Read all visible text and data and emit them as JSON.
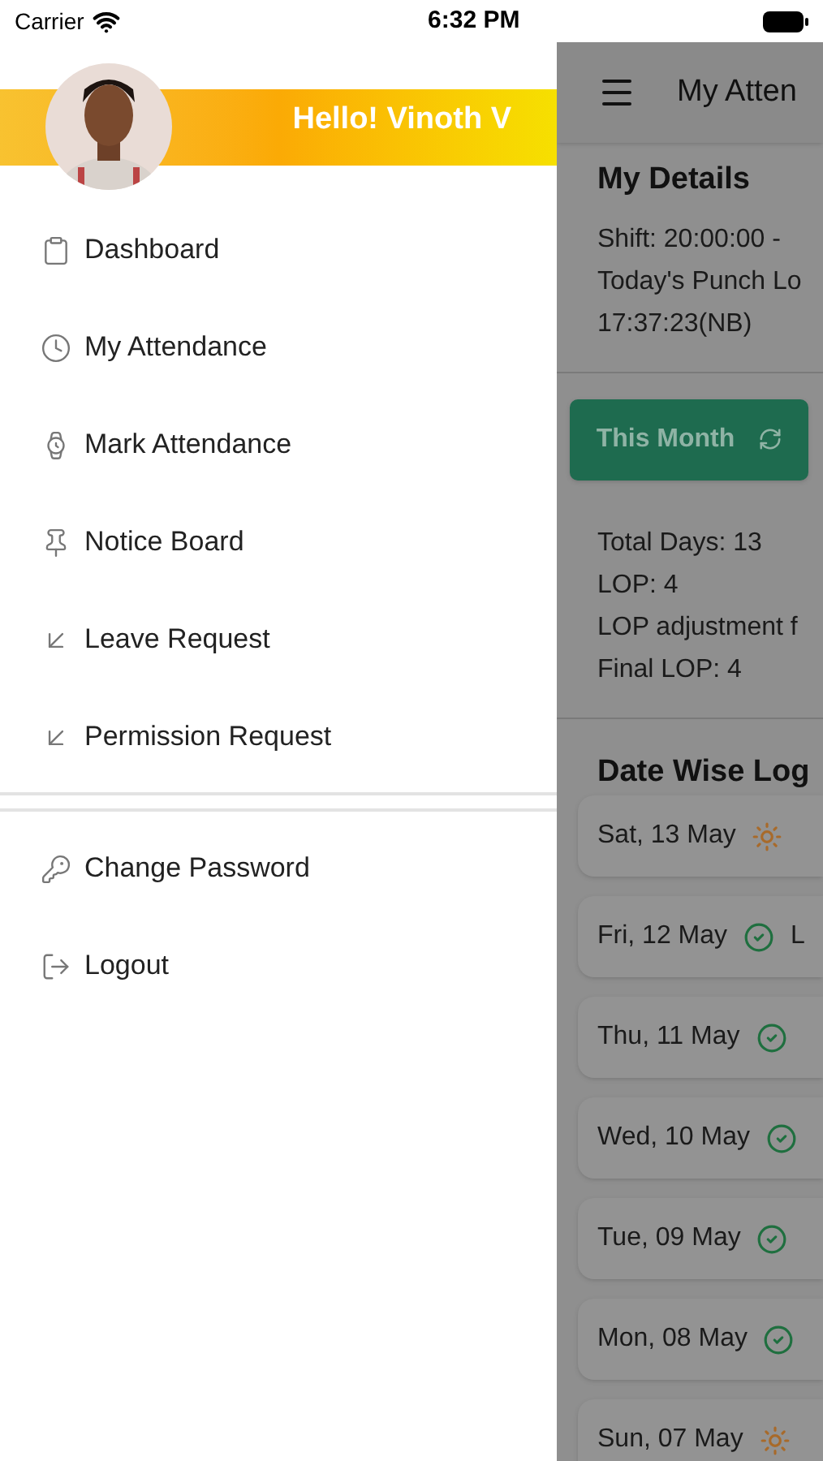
{
  "status_bar": {
    "carrier": "Carrier",
    "time": "6:32 PM"
  },
  "drawer": {
    "greeting": "Hello! Vinoth V",
    "items": [
      {
        "label": "Dashboard"
      },
      {
        "label": "My Attendance"
      },
      {
        "label": "Mark Attendance"
      },
      {
        "label": "Notice Board"
      },
      {
        "label": "Leave Request"
      },
      {
        "label": "Permission Request"
      }
    ],
    "account_items": [
      {
        "label": "Change Password"
      },
      {
        "label": "Logout"
      }
    ]
  },
  "screen": {
    "title": "My Atten",
    "details": {
      "heading": "My Details",
      "lines": [
        "Shift: 20:00:00 -",
        "Today's Punch Lo",
        "17:37:23(NB)"
      ]
    },
    "period_button": "This Month",
    "stats": [
      "Total Days: 13",
      "LOP: 4",
      "LOP adjustment f",
      "Final LOP: 4"
    ],
    "log_heading": "Date Wise Log",
    "log": [
      {
        "date": "Sat, 13 May",
        "kind": "holiday"
      },
      {
        "date": "Fri, 12 May",
        "kind": "present",
        "note": "L"
      },
      {
        "date": "Thu, 11 May",
        "kind": "present"
      },
      {
        "date": "Wed, 10 May",
        "kind": "present"
      },
      {
        "date": "Tue, 09 May",
        "kind": "present"
      },
      {
        "date": "Mon, 08 May",
        "kind": "present"
      },
      {
        "date": "Sun, 07 May",
        "kind": "holiday"
      }
    ]
  }
}
